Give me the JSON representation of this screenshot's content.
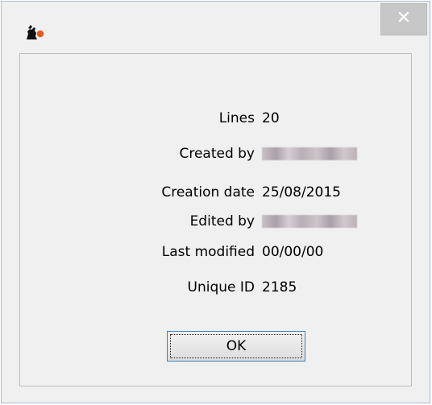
{
  "window": {
    "close_glyph": "✕",
    "app_icon": "app-logo-icon"
  },
  "info": {
    "rows": [
      {
        "label": "Lines",
        "value": "20"
      },
      {
        "label": "Created by",
        "value": ""
      },
      {
        "label": "Creation date",
        "value": "25/08/2015"
      },
      {
        "label": "Edited by",
        "value": ""
      },
      {
        "label": "Last modified",
        "value": "00/00/00"
      },
      {
        "label": "Unique ID",
        "value": "2185"
      }
    ]
  },
  "buttons": {
    "ok_label": "OK"
  },
  "colors": {
    "close_button_bg": "#c7c7c7",
    "ok_border": "#3c7fb1",
    "window_bg": "#f0f0f0"
  }
}
